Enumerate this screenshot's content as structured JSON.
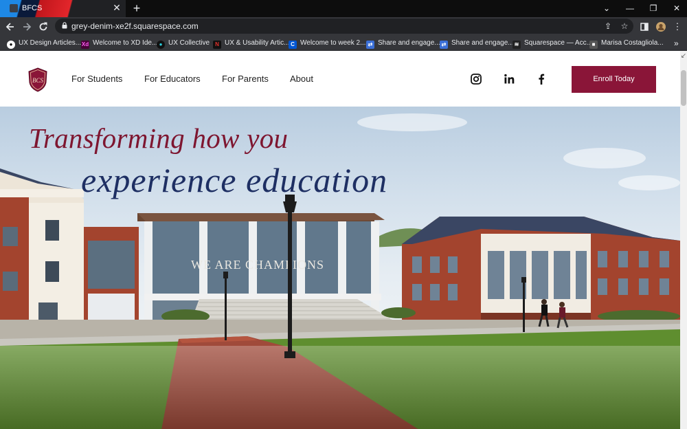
{
  "browser": {
    "tab_title": "BFCS",
    "tab_close": "✕",
    "new_tab": "+",
    "url": "grey-denim-xe2f.squarespace.com",
    "window_controls": [
      "⌄",
      "—",
      "❐",
      "✕"
    ]
  },
  "bookmarks": [
    {
      "label": "UX Design Articles...",
      "icon": "medium-icon",
      "color": "#ffffff",
      "glyph": "●"
    },
    {
      "label": "Welcome to XD Ide...",
      "icon": "xd-icon",
      "color": "#470137",
      "glyph": "Xd"
    },
    {
      "label": "UX Collective",
      "icon": "ux-collective-icon",
      "color": "#111111",
      "glyph": "●"
    },
    {
      "label": "UX & Usability Artic...",
      "icon": "nn-icon",
      "color": "#111111",
      "glyph": "N"
    },
    {
      "label": "Welcome to week 2...",
      "icon": "coursera-icon",
      "color": "#0056d2",
      "glyph": "C"
    },
    {
      "label": "Share and engage...",
      "icon": "share-icon",
      "color": "#3b6fd6",
      "glyph": "⇄"
    },
    {
      "label": "Share and engage...",
      "icon": "share-icon",
      "color": "#3b6fd6",
      "glyph": "⇄"
    },
    {
      "label": "Squarespace — Acc...",
      "icon": "squarespace-icon",
      "color": "#222222",
      "glyph": "≋"
    },
    {
      "label": "Marisa Costagliola...",
      "icon": "cube-icon",
      "color": "#555555",
      "glyph": "■"
    }
  ],
  "bookmarks_more": "»",
  "site": {
    "logo_text": "BCS",
    "nav": [
      "For Students",
      "For Educators",
      "For Parents",
      "About"
    ],
    "social": [
      "instagram-icon",
      "linkedin-icon",
      "facebook-icon"
    ],
    "enroll": "Enroll Today",
    "headline_line1": "Transforming how you",
    "headline_line2": "experience education",
    "building_sign": "WE ARE CHAMPIONS"
  },
  "colors": {
    "brand": "#8a1538",
    "headline_red": "#7e1630",
    "headline_blue": "#1e2f63"
  }
}
